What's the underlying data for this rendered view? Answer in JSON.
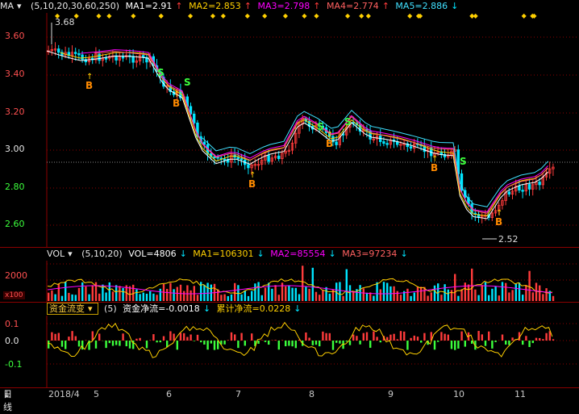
{
  "main": {
    "indicator": "MA",
    "params": "(5,10,20,30,60,250)",
    "ma1": "MA1=2.91",
    "ma2": "MA2=2.853",
    "ma3": "MA3=2.798",
    "ma4": "MA4=2.774",
    "ma5": "MA5=2.886",
    "y_labels": [
      "3.60",
      "3.40",
      "3.20",
      "3.00",
      "2.80",
      "2.60"
    ],
    "high_label": "3.68",
    "low_label": "2.52",
    "buy_label": "B",
    "sell_label": "S"
  },
  "volume": {
    "indicator": "VOL",
    "params": "(5,10,20)",
    "vol": "VOL=4806",
    "ma1": "MA1=106301",
    "ma2": "MA2=85554",
    "ma3": "MA3=97234",
    "y_label": "2000",
    "unit": "x100"
  },
  "flow": {
    "indicator": "资金流变",
    "params": "(5)",
    "net": "资金净流=-0.0018",
    "cum": "累计净流=0.0228",
    "y_labels": [
      "0.1",
      "0.0",
      "-0.1"
    ]
  },
  "axis": {
    "period": "日线",
    "ticks": [
      "2018/4",
      "5",
      "6",
      "7",
      "8",
      "9",
      "10",
      "11"
    ]
  },
  "colors": {
    "candle_up": "#ff3b3b",
    "candle_down": "#00e5ff",
    "ma1": "#ffffff",
    "ma2": "#ffd000",
    "ma3": "#ff00ff",
    "ma4": "#ff6060",
    "ma5": "#40e0ff",
    "grid": "#8b0000"
  }
}
